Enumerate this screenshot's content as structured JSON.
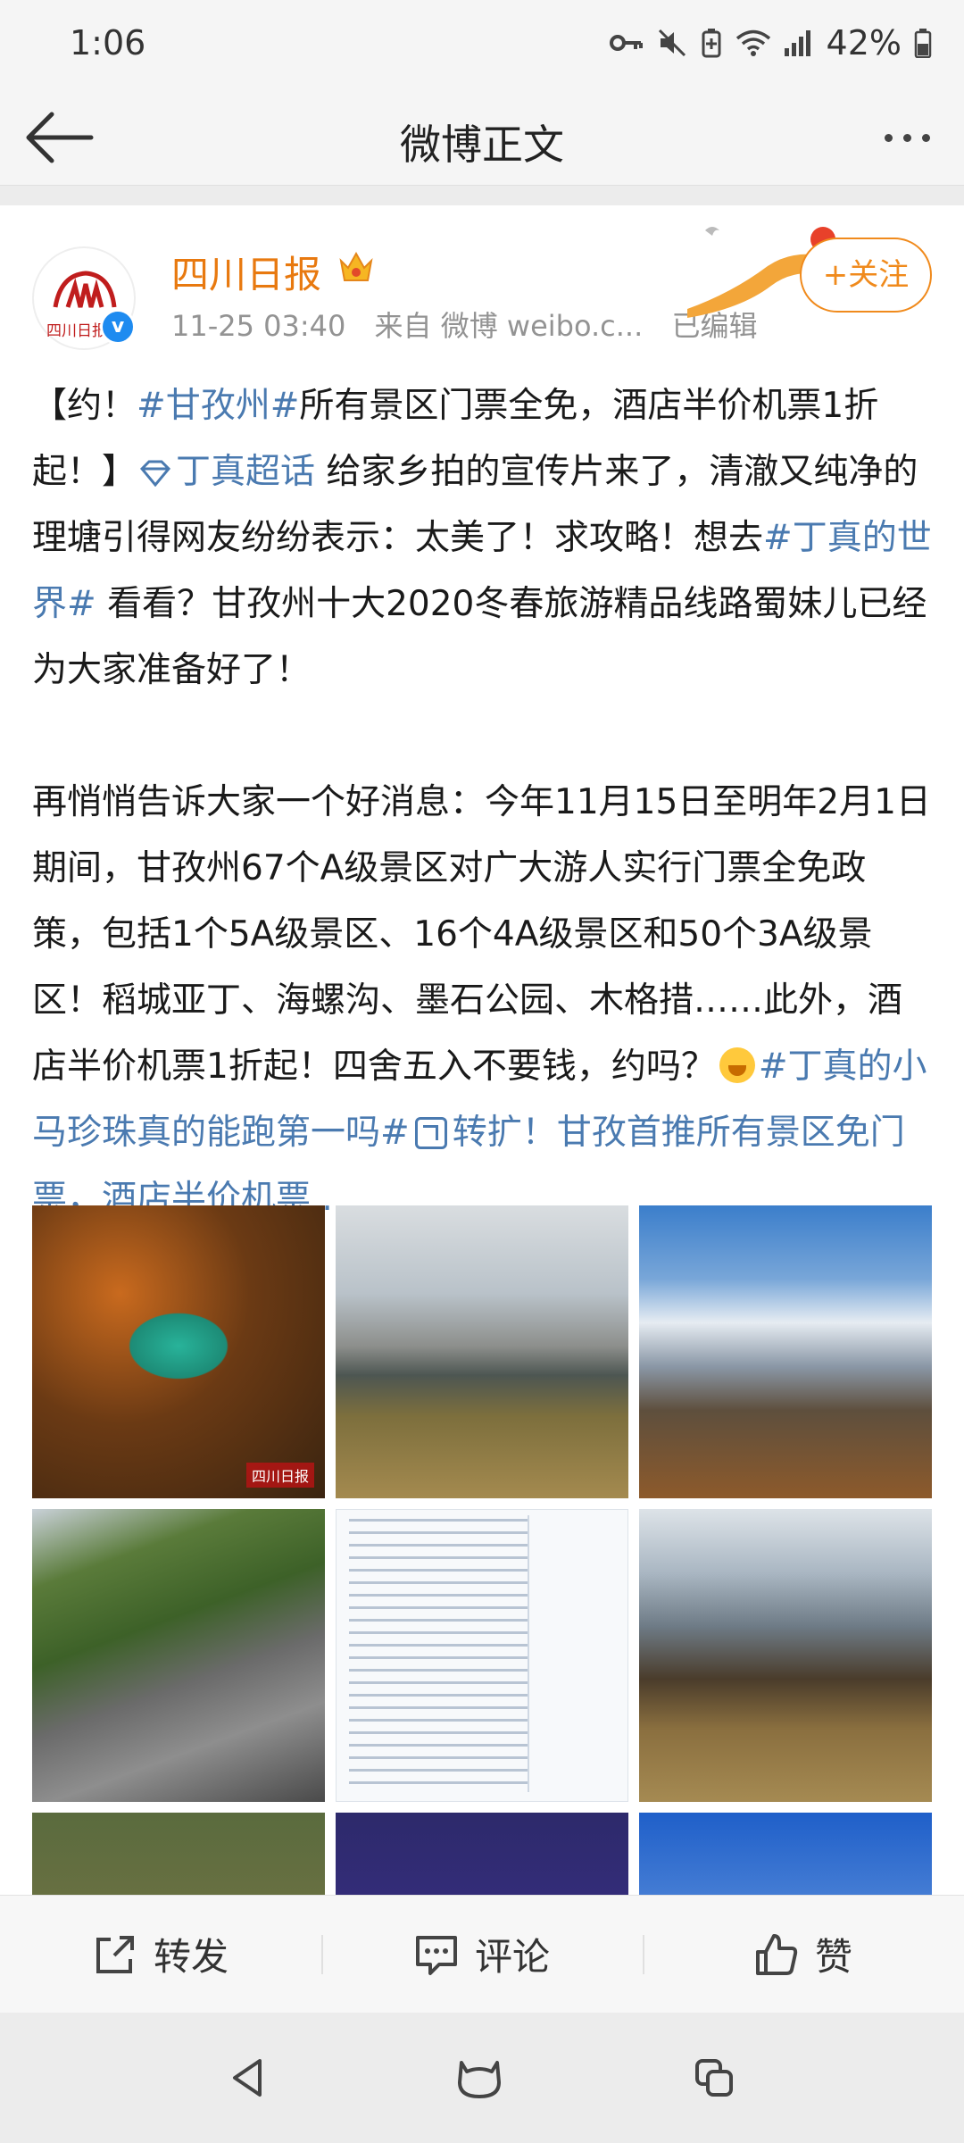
{
  "status_bar": {
    "time": "1:06",
    "battery": "42%",
    "icons": [
      "key-icon",
      "mute-icon",
      "battery-saver-icon",
      "wifi-icon",
      "signal-icon",
      "battery-icon"
    ]
  },
  "title_bar": {
    "title": "微博正文",
    "back_icon": "arrow-left-icon",
    "more_icon": "more-dots-icon"
  },
  "post": {
    "author": "四川日报",
    "avatar_text": "四川日报",
    "time": "11-25 03:40",
    "source": "来自 微博 weibo.c...",
    "edited": "已编辑",
    "follow_label": "+关注",
    "paragraph1": {
      "p1": "【约！",
      "topic1": "#甘孜州#",
      "p2": "所有景区门票全免，酒店半价机票1折起！】",
      "super_topic": "丁真超话",
      "p3": " 给家乡拍的宣传片来了，清澈又纯净的理塘引得网友纷纷表示：太美了！求攻略！想去",
      "topic2": "#丁真的世界#",
      "p4": " 看看？甘孜州十大2020冬春旅游精品线路蜀妹儿已经为大家准备好了！"
    },
    "paragraph2": {
      "p1": "再悄悄告诉大家一个好消息：今年11月15日至明年2月1日期间，甘孜州67个A级景区对广大游人实行门票全免政策，包括1个5A级景区、16个4A级景区和50个3A级景区！稻城亚丁、海螺沟、墨石公园、木格措……此外，酒店半价机票1折起！四舍五入不要钱，约吗？",
      "topic3": "#丁真的小马珍珠真的能跑第一吗#",
      "link_text": "转扩！甘孜首推所有景区免门票，酒店半价机票..."
    },
    "images": [
      {
        "name": "lake-forest-aerial"
      },
      {
        "name": "snow-mountain-grassland"
      },
      {
        "name": "snow-peaks-blue-sky"
      },
      {
        "name": "stone-forest-valley"
      },
      {
        "name": "scenic-spot-list-table"
      },
      {
        "name": "cloudy-hills-grassland"
      },
      {
        "name": "river-aerial"
      },
      {
        "name": "night-sky"
      },
      {
        "name": "blue-sky-clouds"
      }
    ],
    "watermark": "四川日报"
  },
  "actions": {
    "repost": "转发",
    "comment": "评论",
    "like": "赞"
  },
  "nav": [
    "back-triangle-icon",
    "home-icon",
    "recents-icon"
  ],
  "colors": {
    "accent": "#f08a1c",
    "author": "#e8790f",
    "topic": "#4a7ab0",
    "meta": "#939393"
  }
}
